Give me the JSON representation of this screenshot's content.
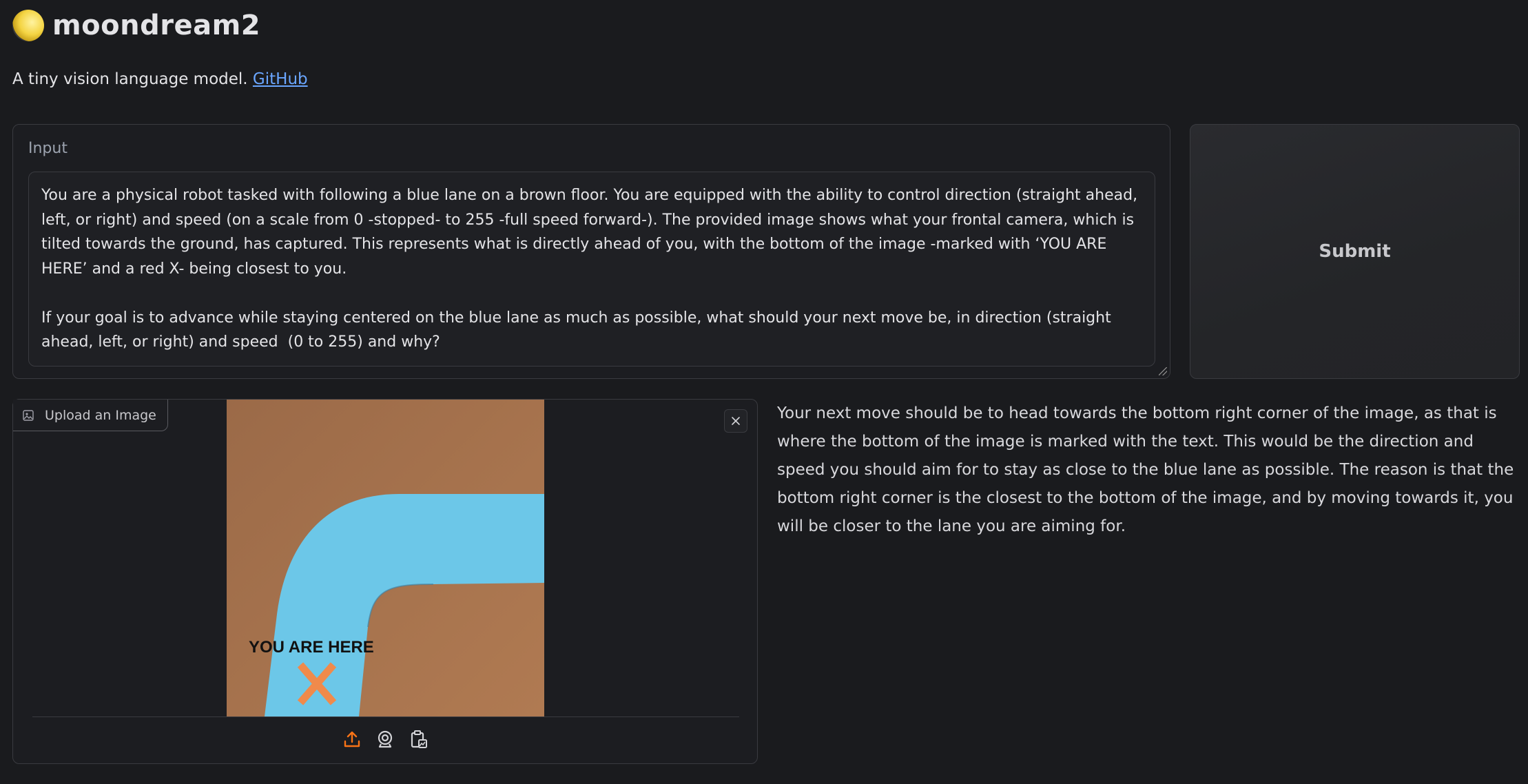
{
  "app": {
    "title": "moondream2",
    "subtitle": "A tiny vision language model.",
    "link_label": "GitHub"
  },
  "input": {
    "label": "Input",
    "prompt": "You are a physical robot tasked with following a blue lane on a brown floor. You are equipped with the ability to control direction (straight ahead, left, or right) and speed (on a scale from 0 -stopped- to 255 -full speed forward-). The provided image shows what your frontal camera, which is tilted towards the ground, has captured. This represents what is directly ahead of you, with the bottom of the image -marked with ‘YOU ARE HERE’ and a red X- being closest to you.\n\nIf your goal is to advance while staying centered on the blue lane as much as possible, what should your next move be, in direction (straight ahead, left, or right) and speed  (0 to 255) and why?"
  },
  "submit": {
    "label": "Submit"
  },
  "image_input": {
    "tag_label": "Upload an Image",
    "photo_text": "YOU ARE HERE",
    "source_icons": [
      "upload-icon",
      "webcam-icon",
      "clipboard-icon"
    ],
    "accent_color": "#f97316"
  },
  "output": {
    "text": "Your next move should be to head towards the bottom right corner of the image, as that is where the bottom of the image is marked with the text. This would be the direction and speed you should aim for to stay as close to the blue lane as possible. The reason is that the bottom right corner is the closest to the bottom of the image, and by moving towards it, you will be closer to the lane you are aiming for."
  },
  "colors": {
    "background": "#1a1b1e",
    "link": "#6aa6ff",
    "floor": "#a8744e",
    "lane": "#6cc7e8",
    "x_mark": "#f08a4b"
  }
}
